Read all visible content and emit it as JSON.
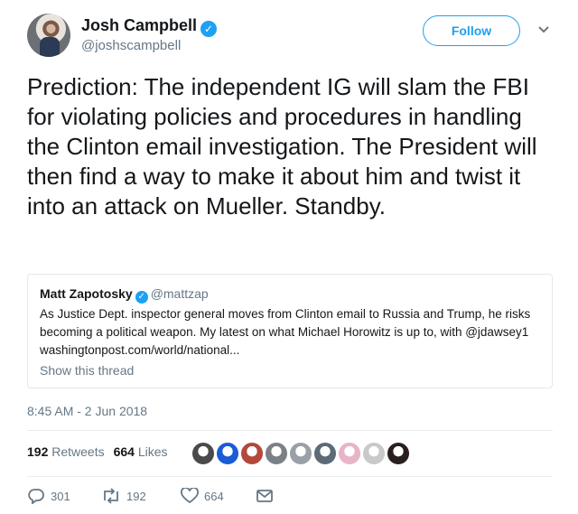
{
  "author": {
    "name": "Josh Campbell",
    "handle": "@joshscampbell",
    "follow_label": "Follow"
  },
  "tweet": {
    "text": "Prediction: The independent IG will slam the FBI for violating policies and procedures in handling the Clinton email investigation. The President will then find a way to make it about him and twist it into an attack on Mueller. Standby.",
    "timestamp": "8:45 AM - 2 Jun 2018"
  },
  "quoted": {
    "name": "Matt Zapotosky",
    "handle": "@mattzap",
    "text": "As Justice Dept. inspector general moves from Clinton email to Russia and Trump, he risks becoming a political weapon. My latest on what Michael Horowitz is up to, with @jdawsey1 washingtonpost.com/world/national...",
    "show_thread": "Show this thread"
  },
  "stats": {
    "retweets_count": "192",
    "retweets_label": "Retweets",
    "likes_count": "664",
    "likes_label": "Likes"
  },
  "likers": [
    {
      "color": "#4a4a4a",
      "icon": "avatar"
    },
    {
      "color": "#1a5bd6",
      "icon": "avatar"
    },
    {
      "color": "#b5473c",
      "icon": "avatar"
    },
    {
      "color": "#7b7f86",
      "icon": "avatar"
    },
    {
      "color": "#9aa0a6",
      "icon": "avatar"
    },
    {
      "color": "#5d6a78",
      "icon": "avatar"
    },
    {
      "color": "#e8b4c8",
      "icon": "avatar"
    },
    {
      "color": "#c9c9c9",
      "icon": "avatar"
    },
    {
      "color": "#2a1f1f",
      "icon": "avatar"
    }
  ],
  "actions": {
    "replies": "301",
    "retweets": "192",
    "likes": "664"
  },
  "colors": {
    "accent": "#1da1f2",
    "muted": "#657786",
    "text": "#14171a"
  }
}
